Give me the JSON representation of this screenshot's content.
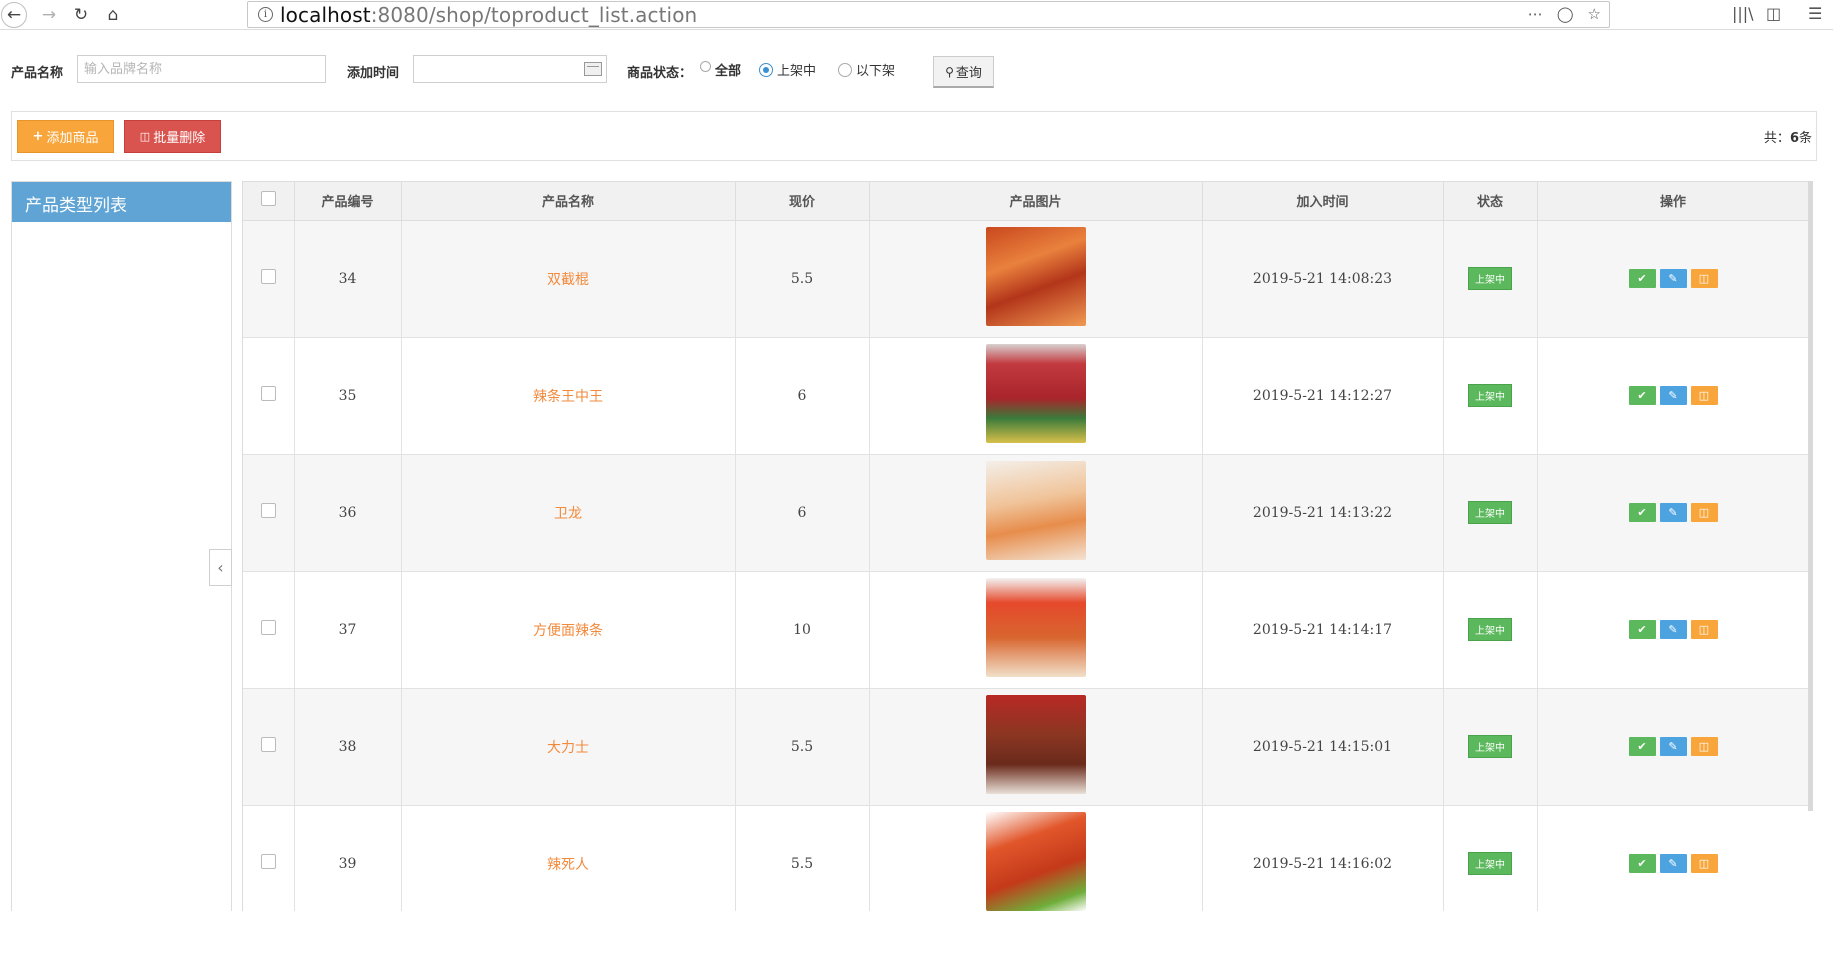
{
  "browser": {
    "url_host": "localhost",
    "url_rest": ":8080/shop/toproduct_list.action",
    "more_icon": "more-dots-icon",
    "pocket_icon": "pocket-icon",
    "star_icon": "bookmark-star-icon"
  },
  "search": {
    "name_label": "产品名称",
    "name_placeholder": "输入品牌名称",
    "time_label": "添加时间",
    "status_label": "商品状态：",
    "options": [
      "全部",
      "上架中",
      "以下架"
    ],
    "selected": "上架中",
    "query_label": "查询"
  },
  "toolbar": {
    "add_label": "添加商品",
    "delete_label": "批量删除",
    "total_prefix": "共：",
    "total_count": "6",
    "total_suffix": "条"
  },
  "sidebar": {
    "title": "产品类型列表"
  },
  "table": {
    "headers": [
      "产品编号",
      "产品名称",
      "现价",
      "产品图片",
      "加入时间",
      "状态",
      "操作"
    ],
    "rows": [
      {
        "id": "34",
        "name": "双截棍",
        "price": "5.5",
        "time": "2019-5-21 14:08:23",
        "status": "上架中"
      },
      {
        "id": "35",
        "name": "辣条王中王",
        "price": "6",
        "time": "2019-5-21 14:12:27",
        "status": "上架中"
      },
      {
        "id": "36",
        "name": "卫龙",
        "price": "6",
        "time": "2019-5-21 14:13:22",
        "status": "上架中"
      },
      {
        "id": "37",
        "name": "方便面辣条",
        "price": "10",
        "time": "2019-5-21 14:14:17",
        "status": "上架中"
      },
      {
        "id": "38",
        "name": "大力士",
        "price": "5.5",
        "time": "2019-5-21 14:15:01",
        "status": "上架中"
      },
      {
        "id": "39",
        "name": "辣死人",
        "price": "5.5",
        "time": "2019-5-21 14:16:02",
        "status": "上架中"
      }
    ]
  },
  "colors": {
    "accent_blue": "#5fa4d4",
    "orange": "#f8a63b",
    "red": "#d9534f",
    "green": "#5cb85c",
    "product_name": "#f28a3c"
  }
}
